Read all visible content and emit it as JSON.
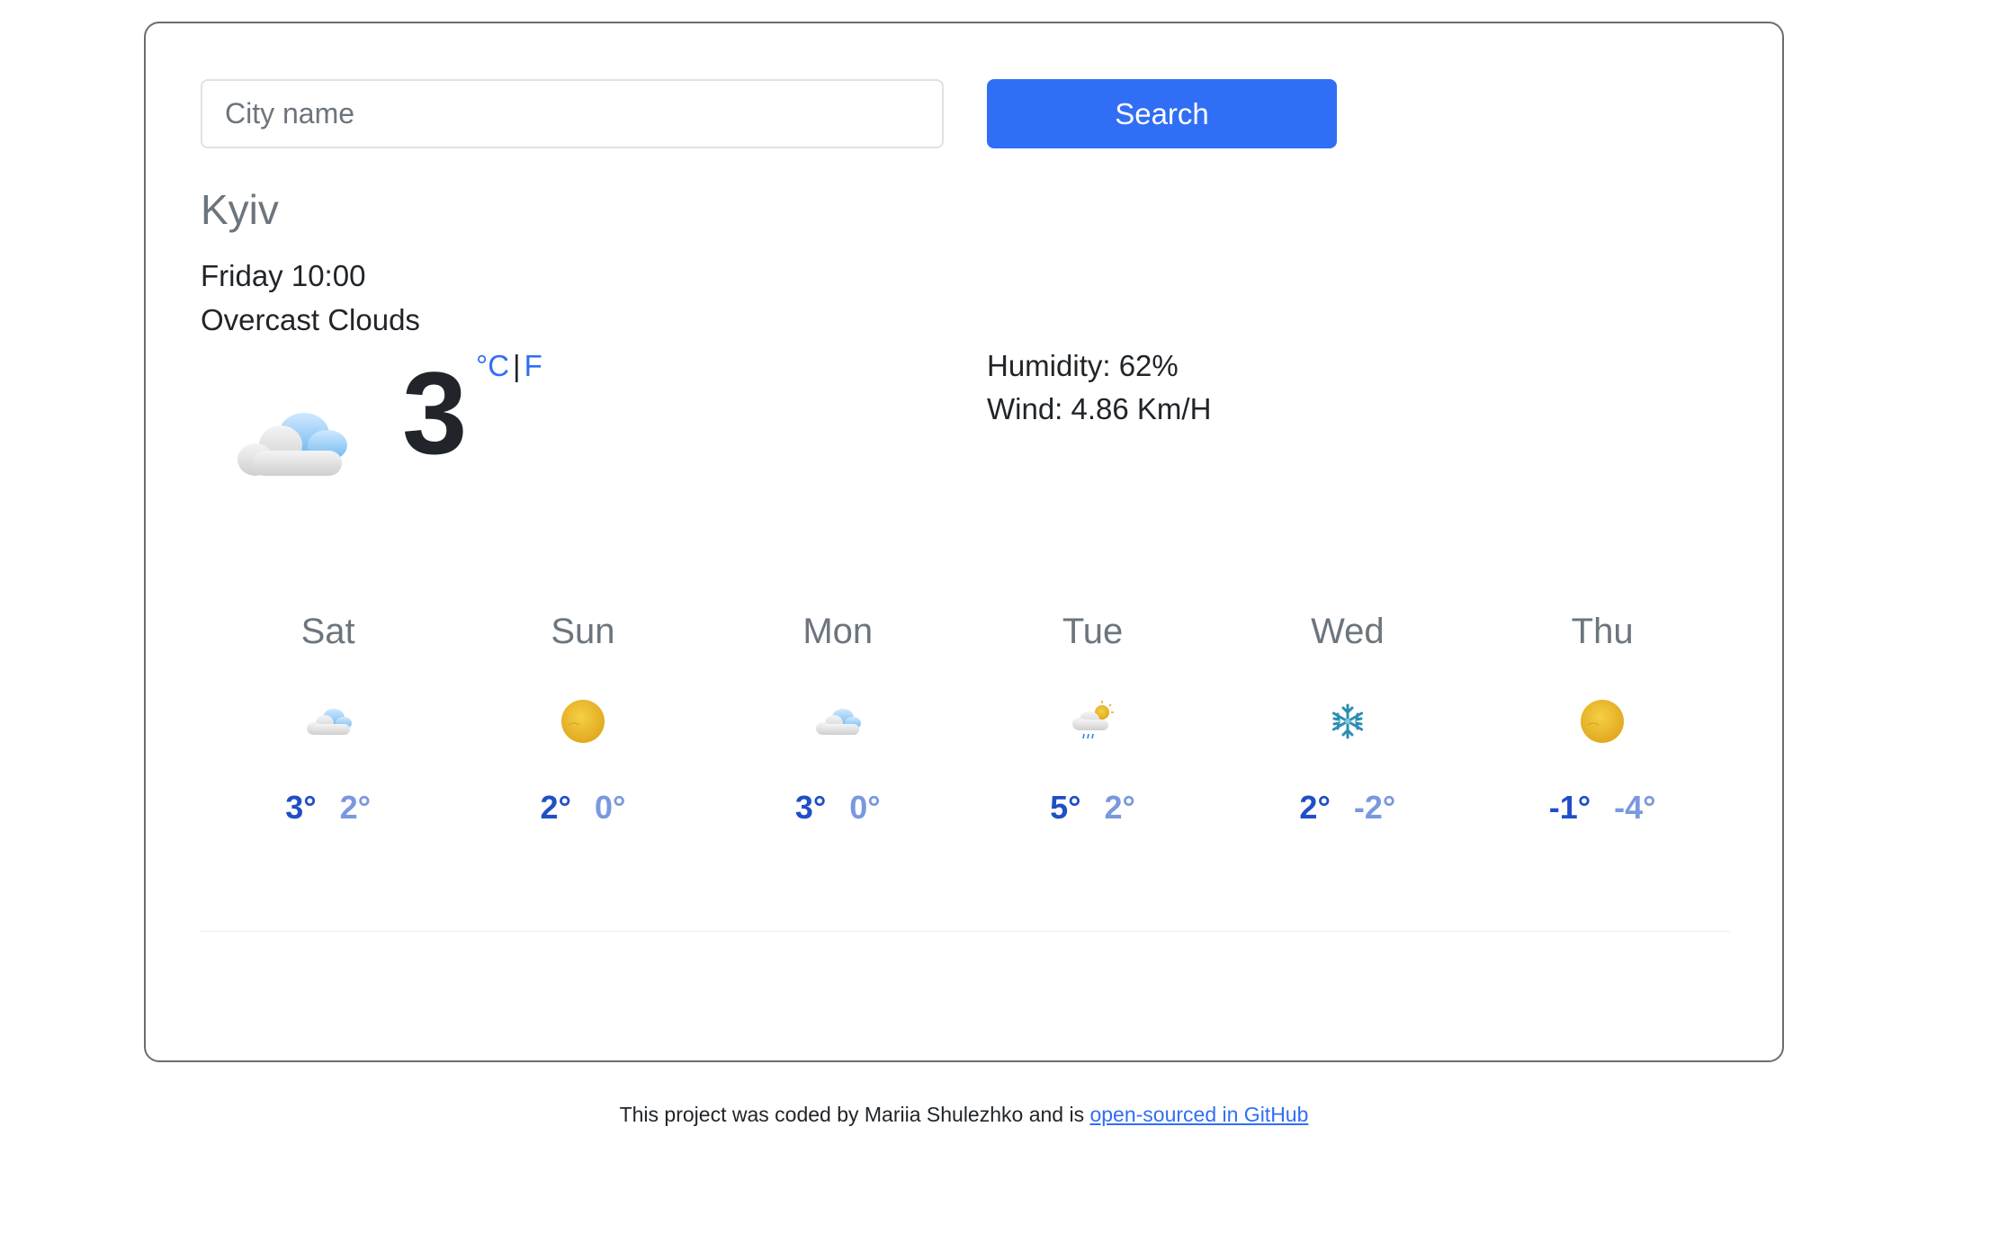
{
  "search": {
    "placeholder": "City name",
    "button_label": "Search"
  },
  "current": {
    "city": "Kyiv",
    "datetime": "Friday 10:00",
    "description": "Overcast Clouds",
    "icon": "overcast-clouds-icon",
    "temperature": "3",
    "unit_celsius": "°C",
    "unit_separator": "|",
    "unit_fahrenheit": "F",
    "humidity": "Humidity: 62%",
    "wind": "Wind: 4.86 Km/H"
  },
  "forecast": [
    {
      "day": "Sat",
      "icon": "clouds-icon",
      "max": "3°",
      "min": "2°"
    },
    {
      "day": "Sun",
      "icon": "sun-icon",
      "max": "2°",
      "min": "0°"
    },
    {
      "day": "Mon",
      "icon": "clouds-icon",
      "max": "3°",
      "min": "0°"
    },
    {
      "day": "Tue",
      "icon": "rain-sun-cloud-icon",
      "max": "5°",
      "min": "2°"
    },
    {
      "day": "Wed",
      "icon": "snowflake-icon",
      "max": "2°",
      "min": "-2°"
    },
    {
      "day": "Thu",
      "icon": "sun-icon",
      "max": "-1°",
      "min": "-4°"
    }
  ],
  "footer": {
    "text": "This project was coded by Mariia Shulezhko and is ",
    "link_text": "open-sourced in GitHub"
  },
  "colors": {
    "accent": "#306ef5",
    "temp_max": "#1f4fc7",
    "temp_min": "#7a98e0"
  }
}
